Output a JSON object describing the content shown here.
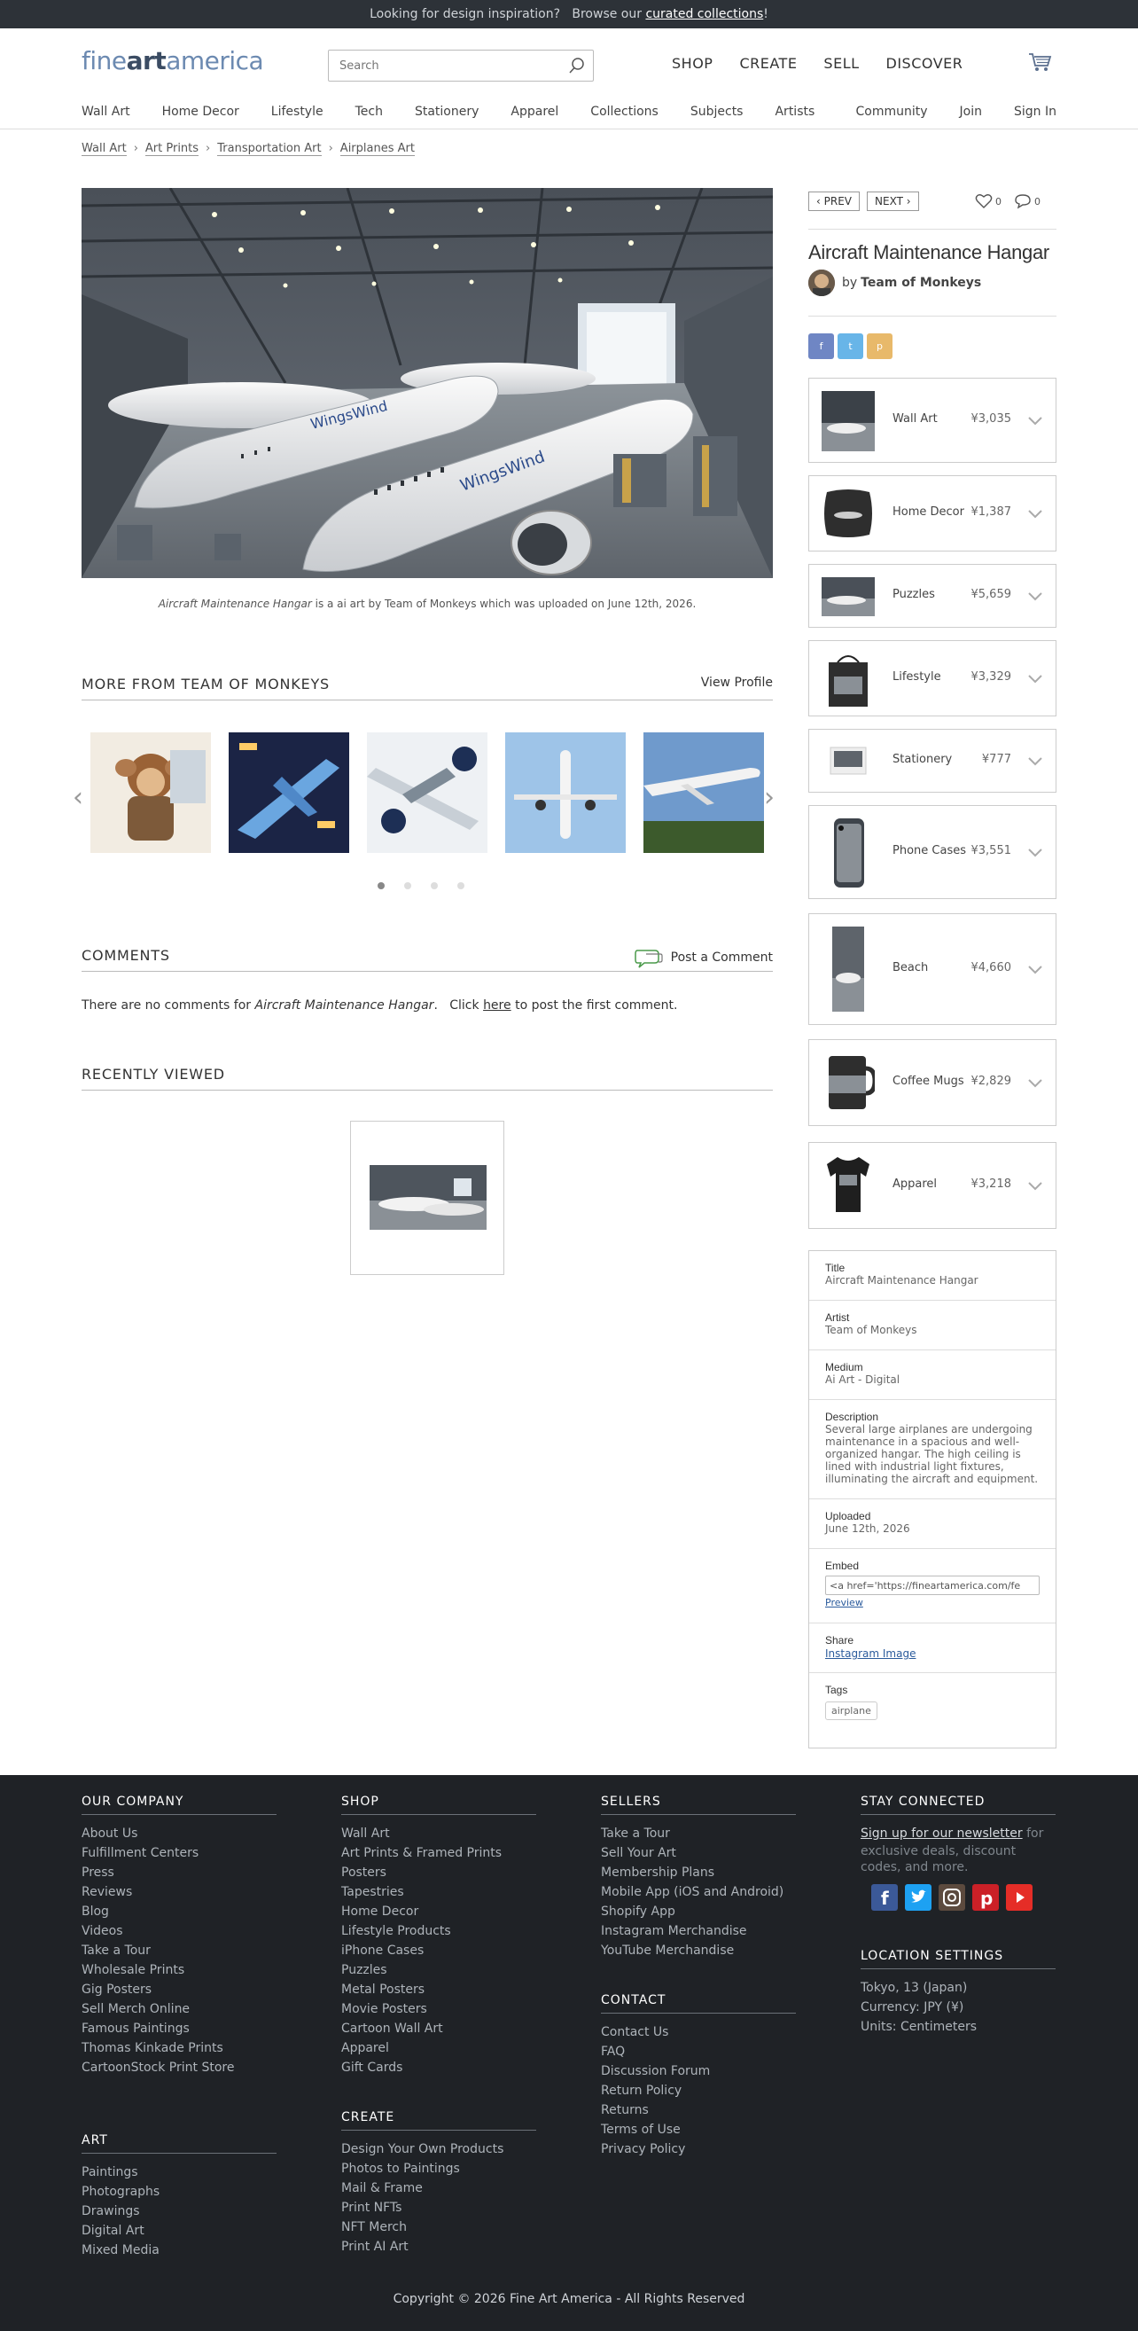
{
  "banner": {
    "text1": "Looking for design inspiration?",
    "text2": "Browse our",
    "link": "curated collections",
    "end": "!"
  },
  "header": {
    "logo_a": "fine",
    "logo_b": "art",
    "logo_c": "america",
    "search_placeholder": "Search",
    "nav": [
      "SHOP",
      "CREATE",
      "SELL",
      "DISCOVER"
    ]
  },
  "subnav": {
    "left": [
      "Wall Art",
      "Home Decor",
      "Lifestyle",
      "Tech",
      "Stationery",
      "Apparel",
      "Collections",
      "Subjects",
      "Artists"
    ],
    "right": [
      "Community",
      "Join",
      "Sign In"
    ]
  },
  "breadcrumb": [
    "Wall Art",
    "Art Prints",
    "Transportation Art",
    "Airplanes Art"
  ],
  "artwork": {
    "title": "Aircraft Maintenance Hangar",
    "caption_rest": " is a ai art by Team of Monkeys which was uploaded on June 12th, 2026.",
    "artist_prefix": "by",
    "artist": "Team of Monkeys"
  },
  "pager": {
    "prev": "PREV",
    "next": "NEXT",
    "likes": "0",
    "comments": "0"
  },
  "more_from": {
    "title": "MORE FROM TEAM OF MONKEYS",
    "view": "View Profile"
  },
  "comments": {
    "title": "COMMENTS",
    "post": "Post a Comment",
    "text1": "There are no comments for ",
    "title_italic": "Aircraft Maintenance Hangar",
    "text2": ".   Click ",
    "here": "here",
    "text3": " to post the first comment."
  },
  "recently_viewed": {
    "title": "RECENTLY VIEWED"
  },
  "products": [
    {
      "name": "Wall Art",
      "price": "¥3,035"
    },
    {
      "name": "Home Decor",
      "price": "¥1,387"
    },
    {
      "name": "Puzzles",
      "price": "¥5,659"
    },
    {
      "name": "Lifestyle",
      "price": "¥3,329"
    },
    {
      "name": "Stationery",
      "price": "¥777"
    },
    {
      "name": "Phone Cases",
      "price": "¥3,551"
    },
    {
      "name": "Beach",
      "price": "¥4,660"
    },
    {
      "name": "Coffee Mugs",
      "price": "¥2,829"
    },
    {
      "name": "Apparel",
      "price": "¥3,218"
    }
  ],
  "details": {
    "title_label": "Title",
    "title_val": "Aircraft Maintenance Hangar",
    "artist_label": "Artist",
    "artist_val": "Team of Monkeys",
    "medium_label": "Medium",
    "medium_val": "Ai Art - Digital",
    "desc_label": "Description",
    "desc_val": "Several large airplanes are undergoing maintenance in a spacious and well-organized hangar. The high ceiling is lined with industrial light fixtures, illuminating the aircraft and equipment.",
    "uploaded_label": "Uploaded",
    "uploaded_val": "June 12th, 2026",
    "embed_label": "Embed",
    "embed_val": "<a href='https://fineartamerica.com/fe",
    "preview": "Preview",
    "share_label": "Share",
    "share_val": "Instagram Image",
    "tags_label": "Tags",
    "tag": "airplane"
  },
  "footer": {
    "company": {
      "title": "OUR COMPANY",
      "links": [
        "About Us",
        "Fulfillment Centers",
        "Press",
        "Reviews",
        "Blog",
        "Videos",
        "Take a Tour",
        "Wholesale Prints",
        "Gig Posters",
        "Sell Merch Online",
        "Famous Paintings",
        "Thomas Kinkade Prints",
        "CartoonStock Print Store"
      ]
    },
    "art": {
      "title": "ART",
      "links": [
        "Paintings",
        "Photographs",
        "Drawings",
        "Digital Art",
        "Mixed Media"
      ]
    },
    "shop": {
      "title": "SHOP",
      "links": [
        "Wall Art",
        "Art Prints & Framed Prints",
        "Posters",
        "Tapestries",
        "Home Decor",
        "Lifestyle Products",
        "iPhone Cases",
        "Puzzles",
        "Metal Posters",
        "Movie Posters",
        "Cartoon Wall Art",
        "Apparel",
        "Gift Cards"
      ]
    },
    "create": {
      "title": "CREATE",
      "links": [
        "Design Your Own Products",
        "Photos to Paintings",
        "Mail & Frame",
        "Print NFTs",
        "NFT Merch",
        "Print AI Art"
      ]
    },
    "sellers": {
      "title": "SELLERS",
      "links": [
        "Take a Tour",
        "Sell Your Art",
        "Membership Plans",
        "Mobile App (iOS and Android)",
        "Shopify App",
        "Instagram Merchandise",
        "YouTube Merchandise"
      ]
    },
    "contact": {
      "title": "CONTACT",
      "links": [
        "Contact Us",
        "FAQ",
        "Discussion Forum",
        "Return Policy",
        "Returns",
        "Terms of Use",
        "Privacy Policy"
      ]
    },
    "stay": {
      "title": "STAY CONNECTED",
      "newsletter": "Sign up for our newsletter",
      "rest": " for exclusive deals, discount codes, and more."
    },
    "location": {
      "title": "LOCATION SETTINGS",
      "lines": [
        "Tokyo, 13 (Japan)",
        "Currency: JPY (¥)",
        "Units: Centimeters"
      ]
    },
    "copyright": "Copyright © 2026 Fine Art America - All Rights Reserved"
  },
  "colors": {
    "banner": "#2d3238",
    "footer": "#1f2226",
    "logo": "#6c8ab1",
    "link_blue": "#2b5b9c"
  }
}
